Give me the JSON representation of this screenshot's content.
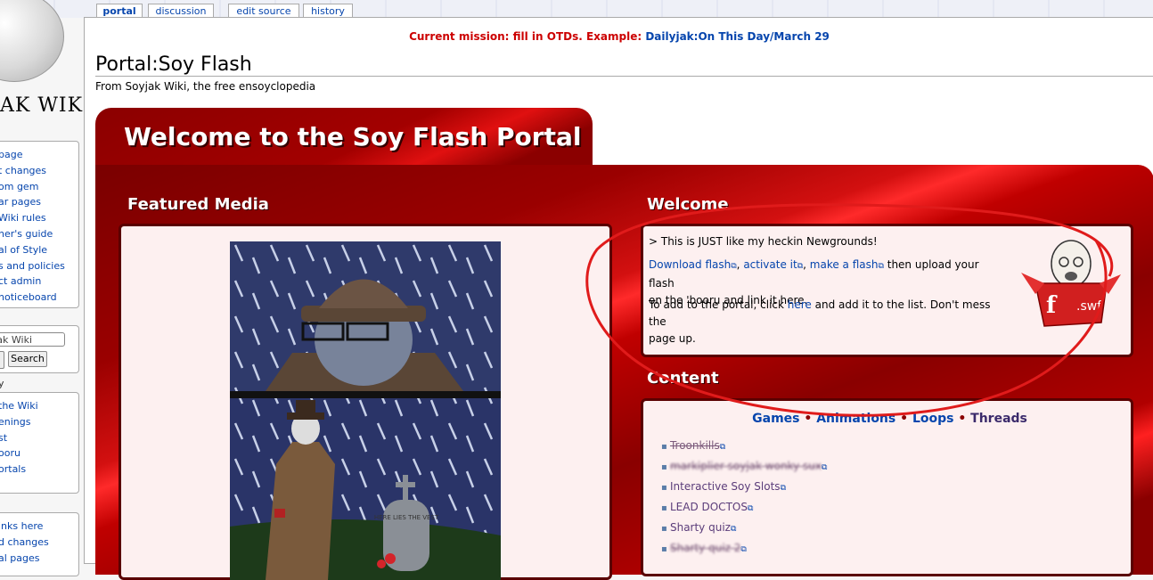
{
  "logo": {
    "text": "AK WIKI"
  },
  "sidebar": {
    "nav": [
      "page",
      "t changes",
      "om gem",
      "ar pages",
      "Wiki rules",
      "her's guide",
      "al of Style",
      "s and policies",
      "ct admin",
      "noticeboard"
    ],
    "search_placeholder": "Soyjak Wiki",
    "search_button": "Search",
    "heading": "y",
    "community": [
      "the Wiki",
      "enings",
      "st",
      "ooru",
      "ortals"
    ],
    "tools": [
      "inks here",
      "d changes",
      "al pages"
    ]
  },
  "tabs": [
    "portal",
    "discussion",
    "edit source",
    "history"
  ],
  "notice": {
    "prefix": "Current mission: fill in OTDs. Example: ",
    "link": "Dailyjak:On This Day/March 29"
  },
  "page": {
    "title": "Portal:Soy Flash",
    "subtitle": "From Soyjak Wiki, the free ensoyclopedia"
  },
  "portal": {
    "title": "Welcome to the Soy Flash Portal",
    "featured_heading": "Featured Media",
    "welcome_heading": "Welcome",
    "content_heading": "Content",
    "greentext": "> This is JUST like my heckin Newgrounds!",
    "welcome_line1": {
      "download": "Download flash",
      "activate": "activate it",
      "make": "make a flash",
      "rest": " then upload your flash",
      "rest2": "on the 'booru and link it here."
    },
    "welcome_line2": {
      "a": "To add to the portal, click ",
      "here": "here",
      "b": " and add it to the list. Don't mess the",
      "c": "page up."
    },
    "content_links": [
      "Games",
      "Animations",
      "Loops",
      "Threads"
    ],
    "content_list": [
      {
        "label": "Troonkills",
        "style": "strike"
      },
      {
        "label": "markiplier soyjak wonky sux",
        "style": "blur"
      },
      {
        "label": "Interactive Soy Slots",
        "style": "normal"
      },
      {
        "label": "LEAD DOCTOS",
        "style": "normal"
      },
      {
        "label": "Sharty quiz",
        "style": "normal"
      },
      {
        "label": "Sharty quiz 2",
        "style": "blur"
      }
    ],
    "swf_label": ".swf",
    "tombstone_text": "HERE LIES THE VEST"
  },
  "colors": {
    "portal_red": "#8b0000",
    "annotation_red": "#e01b1b",
    "link": "#0645ad",
    "green": "#789922"
  }
}
